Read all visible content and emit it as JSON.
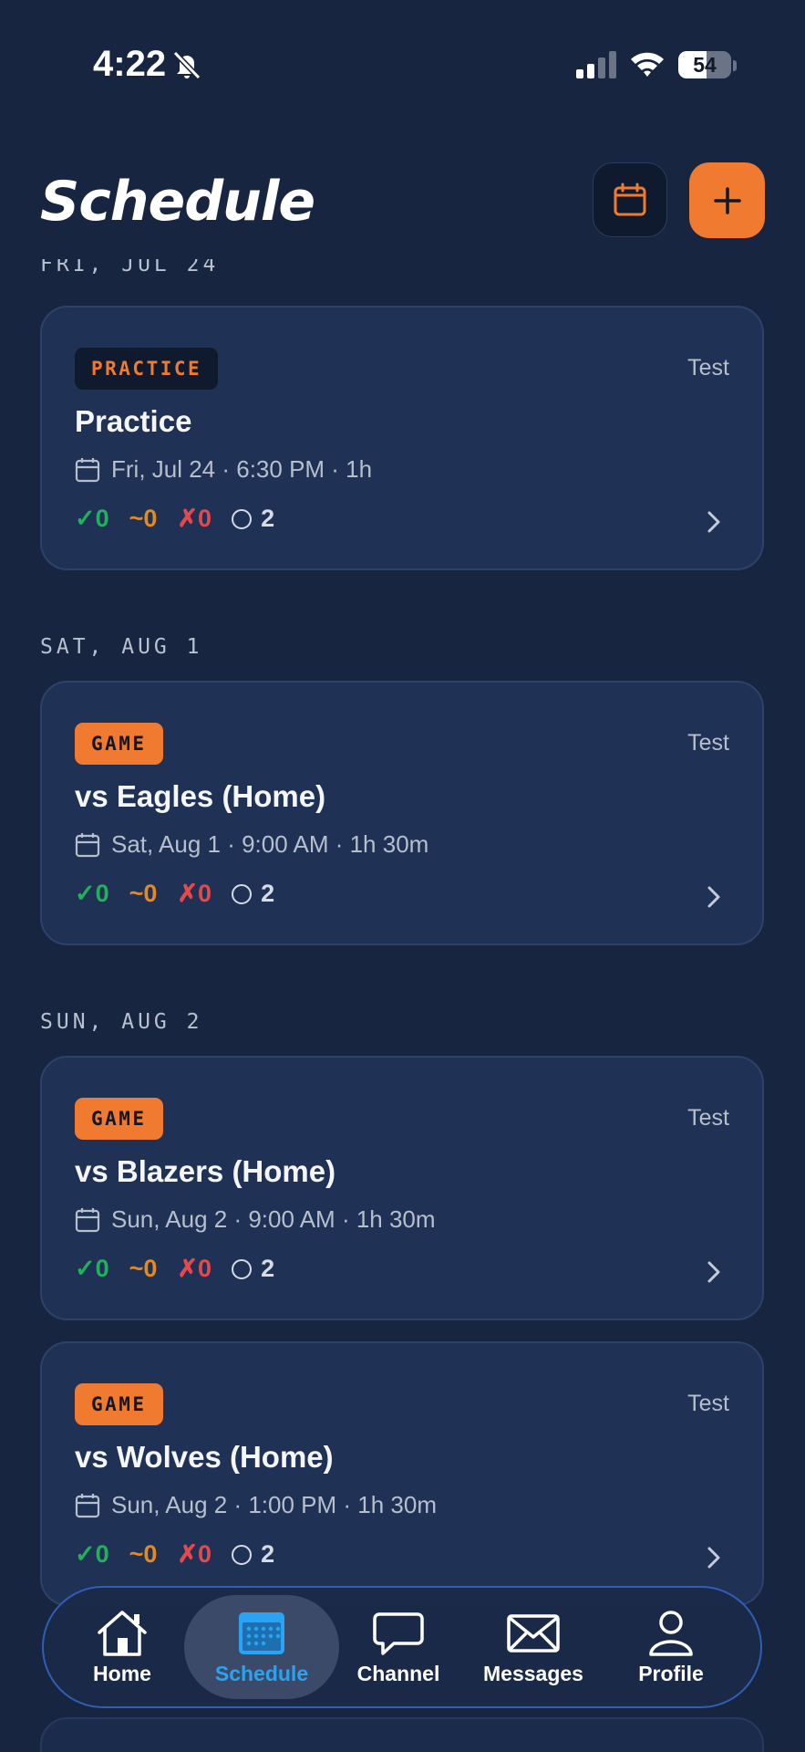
{
  "status_bar": {
    "time": "4:22",
    "battery_level": "54",
    "battery_fraction": 0.54
  },
  "header": {
    "title": "Schedule",
    "calendar_icon": "calendar-icon",
    "add_icon": "plus-icon",
    "accent_color": "#f07a30"
  },
  "sections": [
    {
      "date": "FRI, JUL 24",
      "events": [
        {
          "type": "PRACTICE",
          "team": "Test",
          "title": "Practice",
          "meta": "Fri, Jul 24 · 6:30 PM · 1h",
          "rsvp": {
            "yes": "✓0",
            "maybe": "~0",
            "no": "✗0",
            "pending": "2"
          }
        }
      ]
    },
    {
      "date": "SAT, AUG 1",
      "events": [
        {
          "type": "GAME",
          "team": "Test",
          "title": "vs Eagles (Home)",
          "meta": "Sat, Aug 1 · 9:00 AM · 1h 30m",
          "rsvp": {
            "yes": "✓0",
            "maybe": "~0",
            "no": "✗0",
            "pending": "2"
          }
        }
      ]
    },
    {
      "date": "SUN, AUG 2",
      "events": [
        {
          "type": "GAME",
          "team": "Test",
          "title": "vs Blazers (Home)",
          "meta": "Sun, Aug 2 · 9:00 AM · 1h 30m",
          "rsvp": {
            "yes": "✓0",
            "maybe": "~0",
            "no": "✗0",
            "pending": "2"
          }
        },
        {
          "type": "GAME",
          "team": "Test",
          "title": "vs Wolves (Home)",
          "meta": "Sun, Aug 2 · 1:00 PM · 1h 30m",
          "rsvp": {
            "yes": "✓0",
            "maybe": "~0",
            "no": "✗0",
            "pending": "2"
          }
        }
      ]
    }
  ],
  "tab_bar": {
    "tabs": [
      {
        "label": "Home",
        "icon": "home-icon"
      },
      {
        "label": "Schedule",
        "icon": "calendar-icon",
        "active": true
      },
      {
        "label": "Channel",
        "icon": "chat-bubble-icon"
      },
      {
        "label": "Messages",
        "icon": "envelope-icon"
      },
      {
        "label": "Profile",
        "icon": "person-icon"
      }
    ],
    "active_color": "#2aa3f2"
  }
}
